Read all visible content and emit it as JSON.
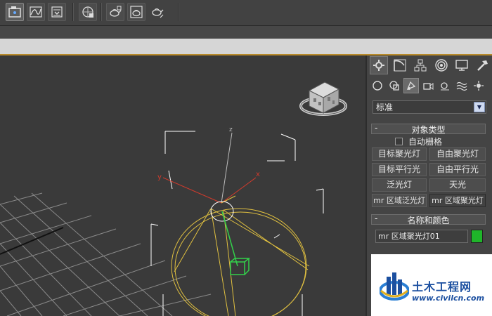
{
  "toolbar": {
    "buttons": [
      "scene-explorer-icon",
      "curve-editor-icon",
      "render-setup-icon",
      "render-frame-icon",
      "teapot-render-icon",
      "teapot-frame-icon",
      "teapot-quick-icon"
    ]
  },
  "viewport": {
    "axis_labels": {
      "z": "z",
      "y": "y",
      "x": "x"
    },
    "colors": {
      "background": "#3a3a3a",
      "grid": "#8a8a8a",
      "light": "#e0c040",
      "selection": "#ffffff",
      "target": "#32d04a"
    }
  },
  "command_panel": {
    "tabs": [
      "create-icon",
      "modify-icon",
      "hierarchy-icon",
      "motion-icon",
      "display-icon",
      "utilities-icon"
    ],
    "subtabs": [
      "geometry-icon",
      "shapes-icon",
      "lights-icon",
      "cameras-icon",
      "helpers-icon",
      "spacewarps-icon",
      "systems-icon"
    ],
    "dropdown_value": "标准",
    "object_type": {
      "header": "对象类型",
      "autogrid_label": "自动栅格",
      "buttons": [
        "目标聚光灯",
        "自由聚光灯",
        "目标平行光",
        "自由平行光",
        "泛光灯",
        "天光",
        "mr 区域泛光灯",
        "mr 区域聚光灯"
      ]
    },
    "name_color": {
      "header": "名称和颜色",
      "name_value": "mr 区域聚光灯01",
      "swatch_color": "#1fb52a"
    },
    "rollout_minus": "-"
  },
  "watermark": {
    "title": "土木工程网",
    "url": "www.civilcn.com",
    "color": "#1b4fa0"
  }
}
